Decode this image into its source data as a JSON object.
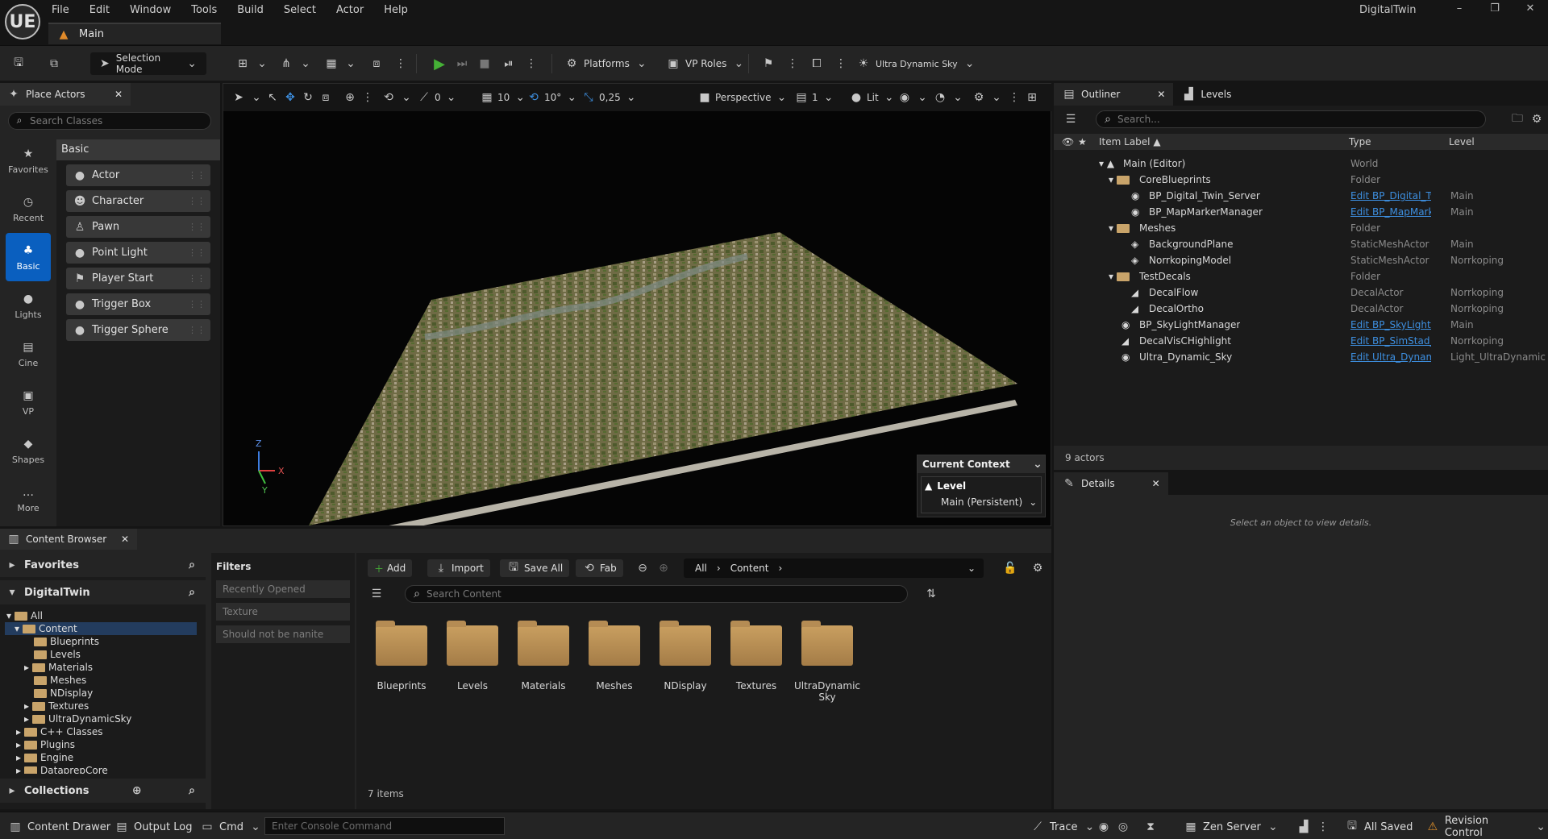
{
  "app": {
    "title": "DigitalTwin",
    "logo": "UE"
  },
  "menu": [
    "File",
    "Edit",
    "Window",
    "Tools",
    "Build",
    "Select",
    "Actor",
    "Help"
  ],
  "window_controls": {
    "minimize": "–",
    "maximize": "❐",
    "close": "✕"
  },
  "map_tab": {
    "label": "Main"
  },
  "toolbar": {
    "mode": "Selection Mode",
    "platforms": "Platforms",
    "vp_roles": "VP Roles",
    "sky": "Ultra Dynamic Sky"
  },
  "place_actors": {
    "title": "Place Actors",
    "search_placeholder": "Search Classes",
    "category": "Basic",
    "categories": [
      "Favorites",
      "Recent",
      "Basic",
      "Lights",
      "Cine",
      "VP",
      "Shapes",
      "More"
    ],
    "items": [
      "Actor",
      "Character",
      "Pawn",
      "Point Light",
      "Player Start",
      "Trigger Box",
      "Trigger Sphere"
    ]
  },
  "viewport": {
    "snap_rotate": "0",
    "grid": "10",
    "angle": "10°",
    "scale": "0,25",
    "view": "Perspective",
    "speed": "1",
    "lit": "Lit",
    "axis": {
      "z": "Z",
      "x": "X",
      "y": "Y"
    },
    "context": {
      "title": "Current Context",
      "level_label": "Level",
      "level_value": "Main (Persistent)"
    }
  },
  "outliner": {
    "tab": "Outliner",
    "tab2": "Levels",
    "search_placeholder": "Search...",
    "columns": {
      "label": "Item Label ▲",
      "type": "Type",
      "level": "Level"
    },
    "rows": [
      {
        "label": "Main (Editor)",
        "type": "World",
        "level": ""
      },
      {
        "label": "CoreBlueprints",
        "type": "Folder",
        "level": ""
      },
      {
        "label": "BP_Digital_Twin_Server",
        "type": "Edit BP_Digital_Twir",
        "level": "Main"
      },
      {
        "label": "BP_MapMarkerManager",
        "type": "Edit BP_MapMarker",
        "level": "Main"
      },
      {
        "label": "Meshes",
        "type": "Folder",
        "level": ""
      },
      {
        "label": "BackgroundPlane",
        "type": "StaticMeshActor",
        "level": "Main"
      },
      {
        "label": "NorrkopingModel",
        "type": "StaticMeshActor",
        "level": "Norrkoping"
      },
      {
        "label": "TestDecals",
        "type": "Folder",
        "level": ""
      },
      {
        "label": "DecalFlow",
        "type": "DecalActor",
        "level": "Norrkoping"
      },
      {
        "label": "DecalOrtho",
        "type": "DecalActor",
        "level": "Norrkoping"
      },
      {
        "label": "BP_SkyLightManager",
        "type": "Edit BP_SkyLightMa",
        "level": "Main"
      },
      {
        "label": "DecalVisCHighlight",
        "type": "Edit BP_SimStad_De",
        "level": "Norrkoping"
      },
      {
        "label": "Ultra_Dynamic_Sky",
        "type": "Edit Ultra_Dynamic_",
        "level": "Light_UltraDynamicS"
      }
    ],
    "footer": "9 actors"
  },
  "details": {
    "title": "Details",
    "message": "Select an object to view details."
  },
  "content_browser": {
    "title": "Content Browser",
    "favorites": "Favorites",
    "project": "DigitalTwin",
    "tree": [
      "All",
      "Content",
      "Blueprints",
      "Levels",
      "Materials",
      "Meshes",
      "NDisplay",
      "Textures",
      "UltraDynamicSky",
      "C++ Classes",
      "Plugins",
      "Engine",
      "DataprepCore"
    ],
    "collections": "Collections",
    "filters": {
      "title": "Filters",
      "items": [
        "Recently Opened",
        "Texture",
        "Should not be nanite"
      ]
    },
    "buttons": {
      "add": "Add",
      "import": "Import",
      "save_all": "Save All",
      "fab": "Fab"
    },
    "breadcrumb": [
      "All",
      "Content"
    ],
    "search_placeholder": "Search Content",
    "assets": [
      "Blueprints",
      "Levels",
      "Materials",
      "Meshes",
      "NDisplay",
      "Textures",
      "UltraDynamic Sky"
    ],
    "count": "7 items"
  },
  "statusbar": {
    "content_drawer": "Content Drawer",
    "output_log": "Output Log",
    "cmd": "Cmd",
    "console_placeholder": "Enter Console Command",
    "trace": "Trace",
    "zen": "Zen Server",
    "saved": "All Saved",
    "revision": "Revision Control"
  }
}
